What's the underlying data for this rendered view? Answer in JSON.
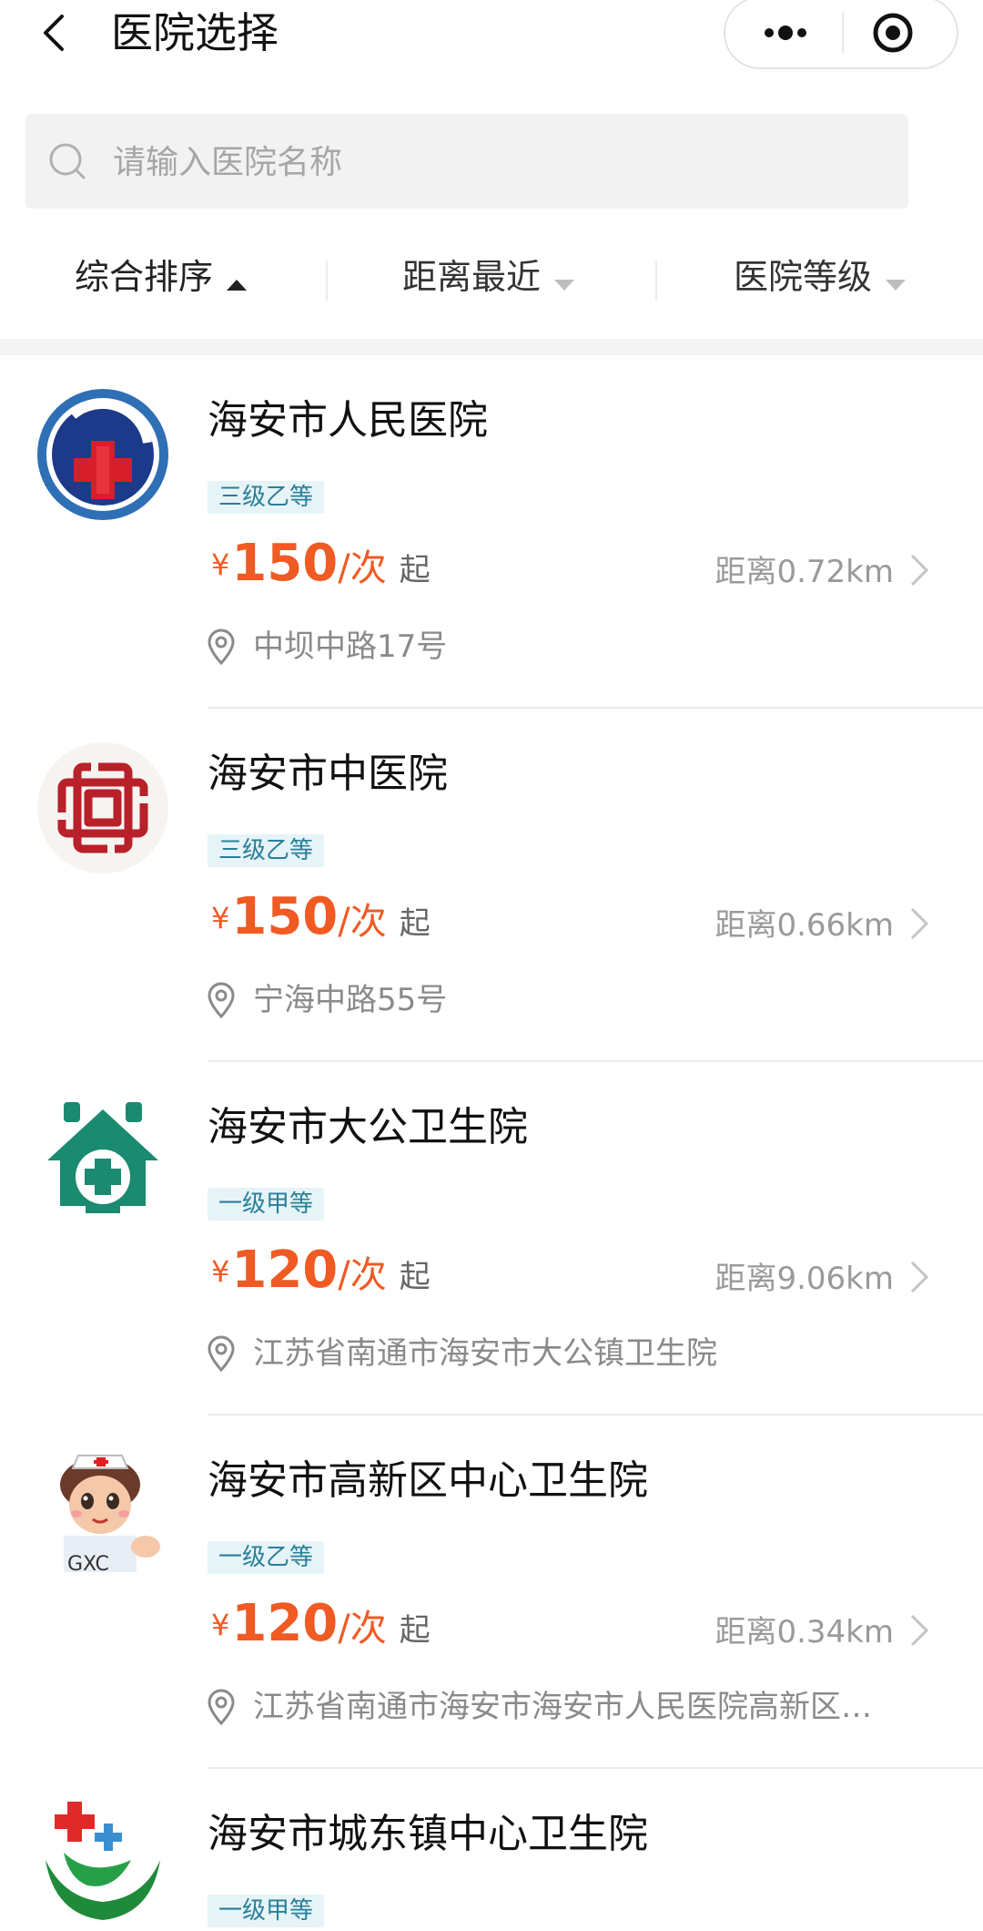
{
  "header": {
    "title": "医院选择"
  },
  "search": {
    "placeholder": "请输入医院名称",
    "value": ""
  },
  "filters": [
    {
      "label": "综合排序",
      "active": true
    },
    {
      "label": "距离最近",
      "active": false
    },
    {
      "label": "医院等级",
      "active": false
    }
  ],
  "colors": {
    "price": "#f05a23",
    "level_bg": "#e6f4f7",
    "level_text": "#2a7f99"
  },
  "hospitals": [
    {
      "name": "海安市人民医院",
      "level": "三级乙等",
      "currency": "¥",
      "price": "150",
      "unit": "/次",
      "suffix": "起",
      "distance": "距离0.72km",
      "address": "中坝中路17号",
      "logo": "hospital-cross-logo"
    },
    {
      "name": "海安市中医院",
      "level": "三级乙等",
      "currency": "¥",
      "price": "150",
      "unit": "/次",
      "suffix": "起",
      "distance": "距离0.66km",
      "address": "宁海中路55号",
      "logo": "chinese-knot-logo"
    },
    {
      "name": "海安市大公卫生院",
      "level": "一级甲等",
      "currency": "¥",
      "price": "120",
      "unit": "/次",
      "suffix": "起",
      "distance": "距离9.06km",
      "address": "江苏省南通市海安市大公镇卫生院",
      "logo": "green-house-cross-logo"
    },
    {
      "name": "海安市高新区中心卫生院",
      "level": "一级乙等",
      "currency": "¥",
      "price": "120",
      "unit": "/次",
      "suffix": "起",
      "distance": "距离0.34km",
      "address": "江苏省南通市海安市海安市人民医院高新区…",
      "logo": "nurse-cartoon-logo"
    },
    {
      "name": "海安市城东镇中心卫生院",
      "level": "一级甲等",
      "logo": "green-hand-cross-logo"
    }
  ]
}
